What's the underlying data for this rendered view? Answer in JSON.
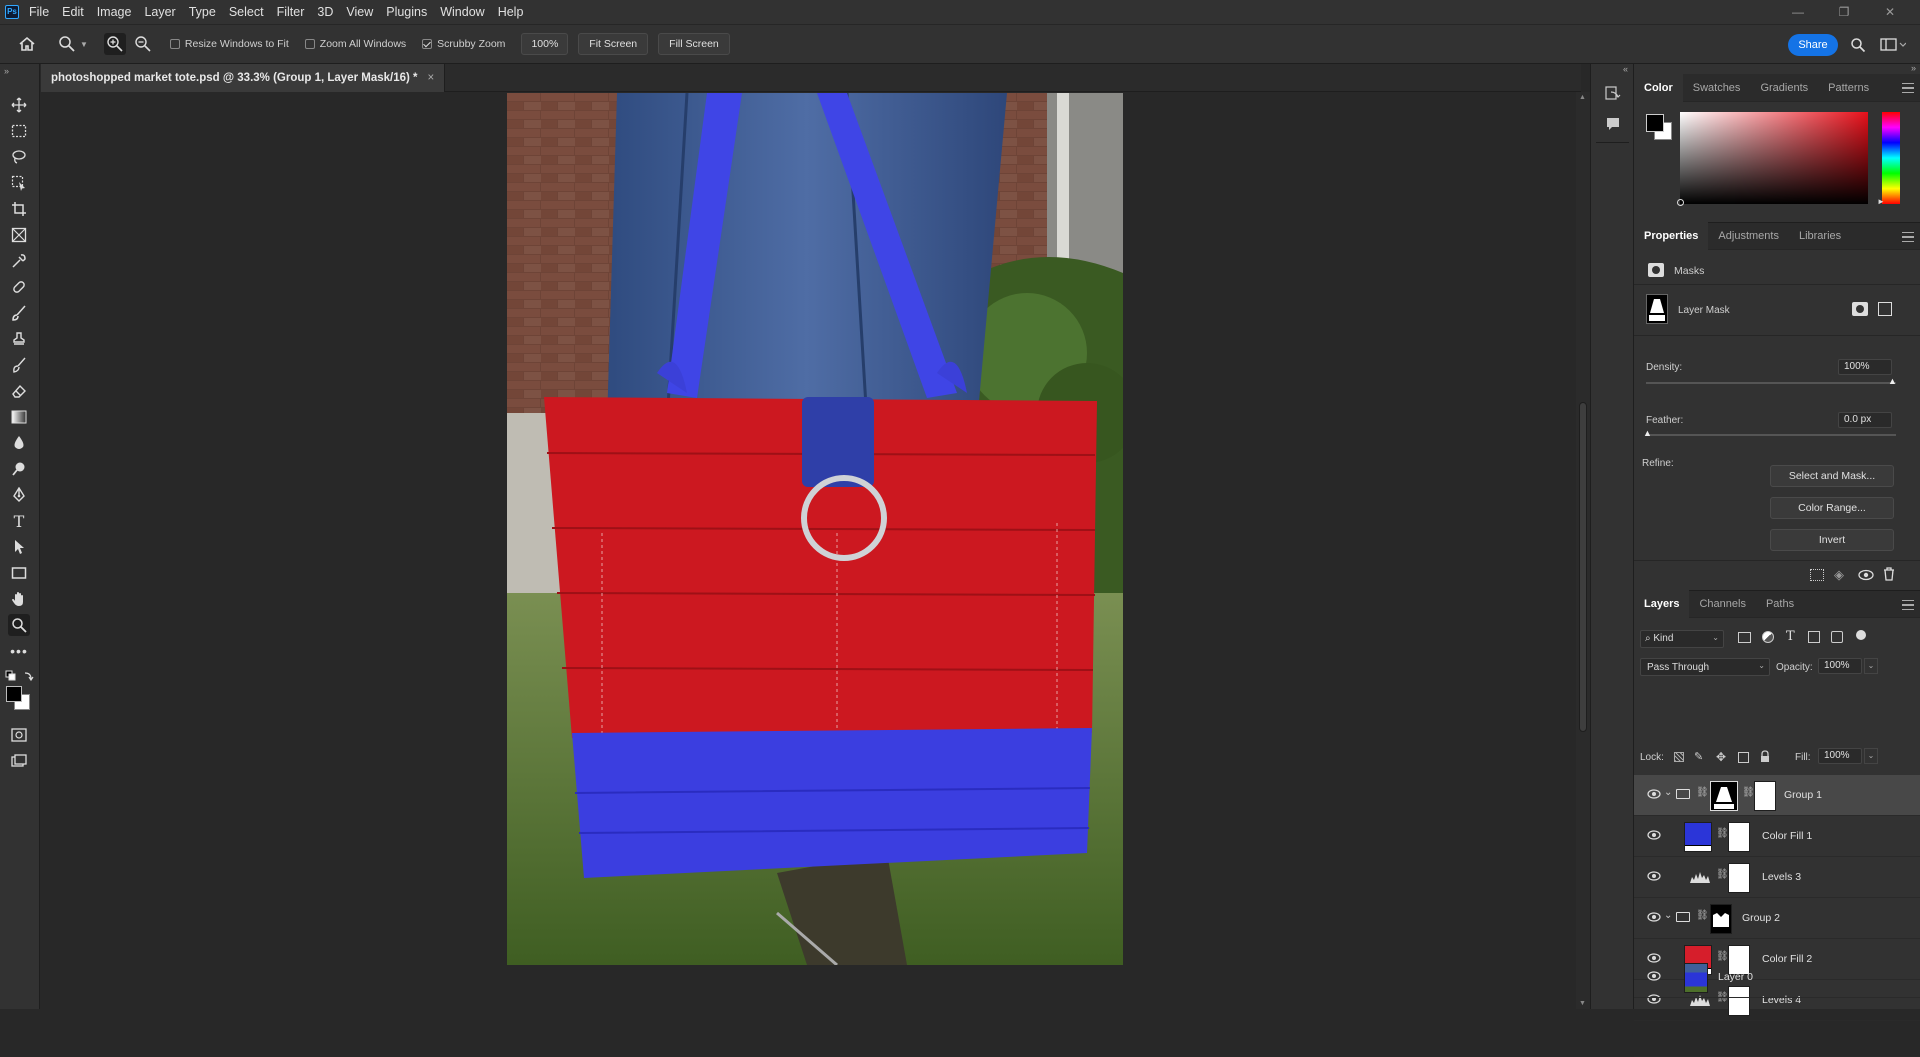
{
  "app": {
    "logo_text": "Ps"
  },
  "menu": [
    "File",
    "Edit",
    "Image",
    "Layer",
    "Type",
    "Select",
    "Filter",
    "3D",
    "View",
    "Plugins",
    "Window",
    "Help"
  ],
  "window_controls": {
    "minimize": "—",
    "restore": "❐",
    "close": "✕"
  },
  "options_bar": {
    "resize_windows_label": "Resize Windows to Fit",
    "zoom_all_label": "Zoom All Windows",
    "scrubby_zoom_label": "Scrubby Zoom",
    "zoom_value": "100%",
    "fit_screen_label": "Fit Screen",
    "fill_screen_label": "Fill Screen",
    "share_label": "Share"
  },
  "document_tab": {
    "title": "photoshopped  market tote.psd @ 33.3% (Group 1, Layer Mask/16) *",
    "close": "×"
  },
  "color_panel": {
    "tabs": [
      "Color",
      "Swatches",
      "Gradients",
      "Patterns"
    ],
    "foreground": "#000000",
    "background": "#ffffff",
    "hue_color": "#e8101a"
  },
  "properties_panel": {
    "tabs": [
      "Properties",
      "Adjustments",
      "Libraries"
    ],
    "section_label": "Masks",
    "mask_label": "Layer Mask",
    "density_label": "Density:",
    "density_value": "100%",
    "feather_label": "Feather:",
    "feather_value": "0.0 px",
    "refine_label": "Refine:",
    "select_and_mask_label": "Select and Mask...",
    "color_range_label": "Color Range...",
    "invert_label": "Invert"
  },
  "layers_panel": {
    "tabs": [
      "Layers",
      "Channels",
      "Paths"
    ],
    "filter_kind": "Kind",
    "blend_mode": "Pass Through",
    "opacity_label": "Opacity:",
    "opacity_value": "100%",
    "lock_label": "Lock:",
    "fill_label": "Fill:",
    "fill_value": "100%",
    "layers": [
      {
        "name": "Group 1",
        "type": "group",
        "selected": true
      },
      {
        "name": "Color Fill 1",
        "type": "fill",
        "color": "#2b35d8"
      },
      {
        "name": "Levels 3",
        "type": "levels"
      },
      {
        "name": "Group 2",
        "type": "group"
      },
      {
        "name": "Color Fill 2",
        "type": "fill",
        "color": "#d61e2b"
      },
      {
        "name": "Levels 4",
        "type": "levels"
      },
      {
        "name": "Layer 0",
        "type": "image"
      }
    ]
  },
  "image_colors": {
    "bag_red": "#cc1820",
    "bag_blue": "#3b3ee0",
    "jeans": "#3f5f9a",
    "grass": "#4d6f2a",
    "brick": "#6e4437"
  }
}
